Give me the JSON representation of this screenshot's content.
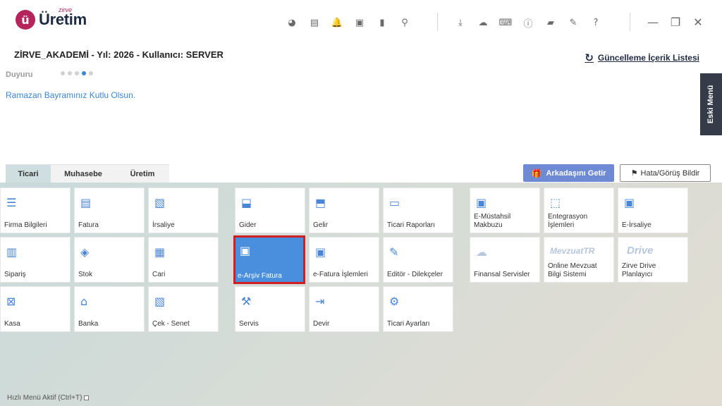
{
  "logo": {
    "badge": "ü",
    "small": "zirve",
    "main": "Üretim"
  },
  "header_icons": {
    "group1": [
      "pie-chart-icon",
      "news-icon",
      "bell-icon",
      "money-icon",
      "book-icon",
      "location-pin-icon"
    ],
    "group1_glyphs": [
      "◕",
      "▤",
      "🔔",
      "▣",
      "▮",
      "⚲"
    ],
    "group2": [
      "download-icon",
      "cloud-upload-icon",
      "keyboard-icon",
      "info-icon",
      "chat-icon",
      "edit-icon",
      "help-icon"
    ],
    "group2_glyphs": [
      "⤓",
      "☁",
      "⌨",
      "ⓘ",
      "▰",
      "✎",
      "?"
    ]
  },
  "window_controls": {
    "minimize": "—",
    "restore": "❐",
    "close": "✕"
  },
  "session": "ZİRVE_AKADEMİ - Yıl: 2026 - Kullanıcı: SERVER",
  "update_link": "Güncelleme İçerik Listesi",
  "announcement": {
    "label": "Duyuru",
    "text": "Ramazan Bayramınız Kutlu Olsun.",
    "dots": 5,
    "active_dot": 3
  },
  "side_menu": "Eski Menü",
  "tabs": [
    {
      "label": "Ticari",
      "active": true
    },
    {
      "label": "Muhasebe",
      "active": false
    },
    {
      "label": "Üretim",
      "active": false
    }
  ],
  "buttons": {
    "friend": "Arkadaşını Getir",
    "report": "Hata/Görüş Bildir"
  },
  "tiles": {
    "firma": "Firma Bilgileri",
    "fatura": "Fatura",
    "irsaliye": "İrsaliye",
    "gider": "Gider",
    "gelir": "Gelir",
    "ticari_raporlar": "Ticari Raporları",
    "e_mustahsil": "E-Müstahsil Makbuzu",
    "entegrasyon": "Entegrasyon İşlemleri",
    "e_irsaliye": "E-İrsaliye",
    "siparis": "Sipariş",
    "stok": "Stok",
    "cari": "Cari",
    "e_arsiv": "e-Arşiv Fatura",
    "e_fatura": "e-Fatura İşlemleri",
    "editor": "Editör - Dilekçeler",
    "finansal": "Finansal Servisler",
    "mevzuat": "Online Mevzuat Bilgi Sistemi",
    "mevzuat_mark": "MevzuatTR",
    "drive": "Zirve Drive Planlayıcı",
    "drive_mark": "Drive",
    "kasa": "Kasa",
    "banka": "Banka",
    "cek": "Çek - Senet",
    "servis": "Servis",
    "devir": "Devir",
    "ticari_ayarlar": "Ticari Ayarları"
  },
  "quick_menu": "Hızlı Menü Aktif (Ctrl+T)"
}
